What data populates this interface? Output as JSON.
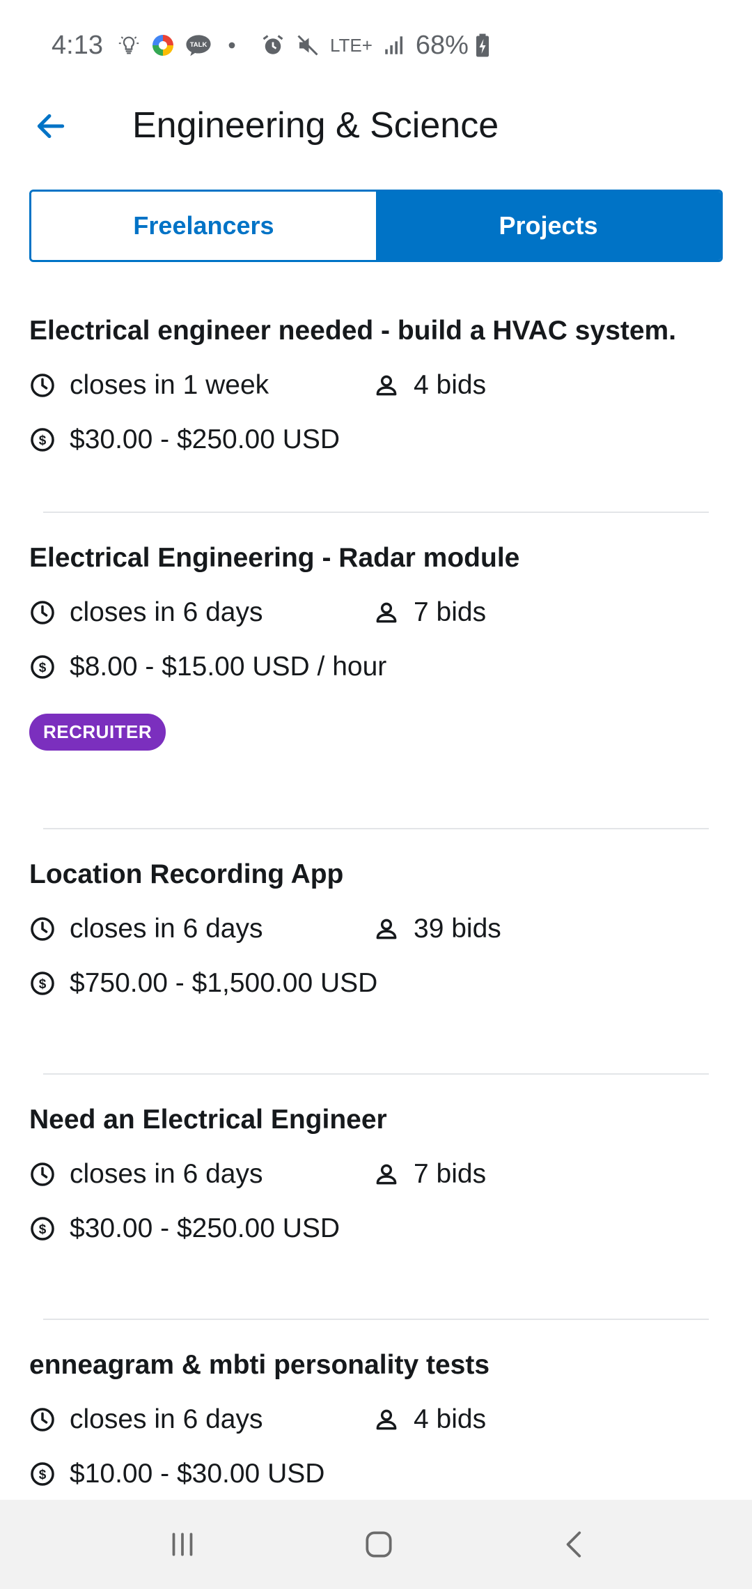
{
  "status_bar": {
    "time": "4:13",
    "network": "LTE+",
    "battery": "68%"
  },
  "header": {
    "title": "Engineering & Science",
    "back_icon": "arrow-left-icon"
  },
  "tabs": [
    {
      "label": "Freelancers",
      "active": false
    },
    {
      "label": "Projects",
      "active": true
    }
  ],
  "projects": [
    {
      "title": "Electrical engineer needed - build a HVAC system.",
      "closes": "closes in 1 week",
      "bids": "4 bids",
      "budget": "$30.00 - $250.00 USD"
    },
    {
      "title": "Electrical Engineering - Radar module",
      "closes": "closes in 6 days",
      "bids": "7 bids",
      "budget": "$8.00 - $15.00 USD / hour",
      "badge": "RECRUITER"
    },
    {
      "title": "Location Recording App",
      "closes": "closes in 6 days",
      "bids": "39 bids",
      "budget": "$750.00 - $1,500.00 USD"
    },
    {
      "title": "Need an Electrical Engineer",
      "closes": "closes in 6 days",
      "bids": "7 bids",
      "budget": "$30.00 - $250.00 USD"
    },
    {
      "title": "enneagram & mbti personality tests",
      "closes": "closes in 6 days",
      "bids": "4 bids",
      "budget": "$10.00 - $30.00 USD"
    }
  ],
  "colors": {
    "accent": "#0073c6",
    "badge": "#7b2fbe",
    "text": "#16191c",
    "divider": "#e3e5e8"
  }
}
